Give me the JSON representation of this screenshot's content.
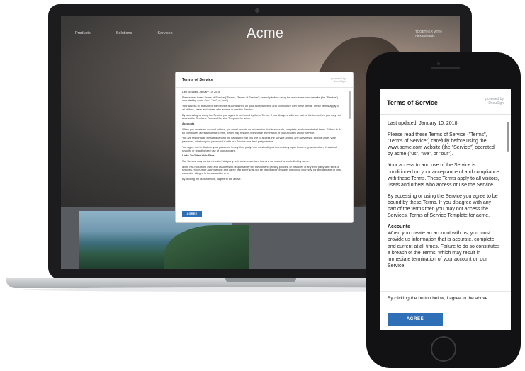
{
  "laptop_site": {
    "nav": [
      "Products",
      "Solutions",
      "Services"
    ],
    "logo": "Acme",
    "logo_sub_line1": "TOGETHER WITH",
    "logo_sub_line2": "Alex Edwards"
  },
  "modal": {
    "title": "Terms of Service",
    "logo_line1": "powered by",
    "logo_line2": "DocuSign",
    "last_updated": "Last updated: January 10, 2018",
    "para1": "Please read these Terms of Service (\"Terms\", \"Terms of Service\") carefully before using the www.acme.com website (the \"Service\") operated by acme (\"us\", \"we\", or \"our\").",
    "para2": "Your access to and use of the Service is conditioned on your acceptance of and compliance with these Terms. These Terms apply to all visitors, users and others who access or use the Service.",
    "para3": "By accessing or using the Service you agree to be bound by these Terms. If you disagree with any part of the terms then you may not access the Services. Terms of Service Template for acme.",
    "accounts_heading": "Accounts",
    "accounts_text": "When you create an account with us, you must provide us information that is accurate, complete, and current at all times. Failure to do so constitutes a breach of the Terms, which may result in immediate termination of your account on our Service.",
    "laptop_para5": "You are responsible for safeguarding the password that you use to access the Service and for any activities or actions under your password, whether your password is with our Service or a third-party service.",
    "laptop_para6": "You agree not to disclose your password to any third party. You must notify us immediately upon becoming aware of any breach of security or unauthorized use of your account.",
    "links_heading": "Links To Other Web Sites",
    "links_text": "Our Service may contain links to third-party web sites or services that are not owned or controlled by acme.",
    "laptop_para8": "acme has no control over, and assumes no responsibility for, the content, privacy policies, or practices of any third party web sites or services. You further acknowledge and agree that acme shall not be responsible or liable, directly or indirectly, for any damage or loss caused or alleged to be caused by or in",
    "footer_text": "By clicking the button below, I agree to the above.",
    "agree_label": "AGREE"
  }
}
